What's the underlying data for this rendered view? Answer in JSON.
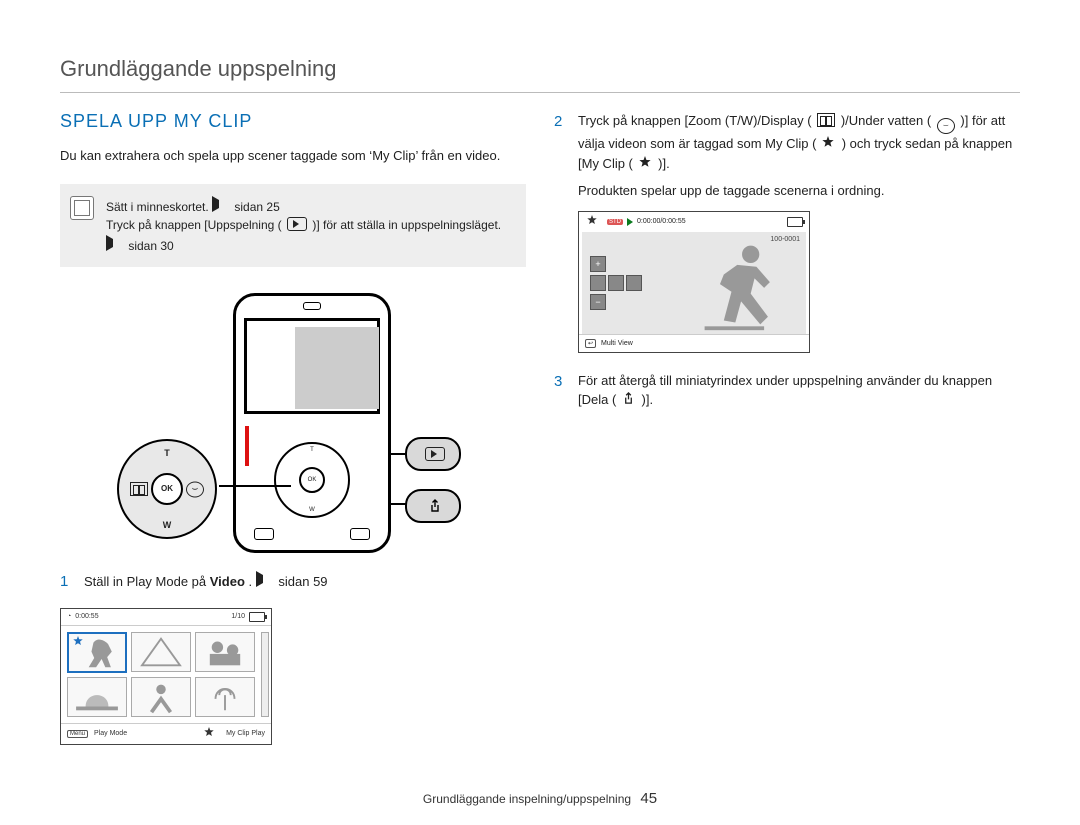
{
  "chapter_title": "Grundläggande uppspelning",
  "section_title": "SPELA UPP MY CLIP",
  "intro": "Du kan extrahera och spela upp scener taggade som ‘My Clip’ från en video.",
  "note": {
    "l1_pre": "Sätt i minneskortet. ",
    "l1_ref": "sidan 25",
    "l2_pre": "Tryck på knappen [Uppspelning (",
    "l2_post": ")] för att ställa in uppspelningsläget. ",
    "l2_ref": "sidan 30"
  },
  "device": {
    "ok": "OK",
    "t": "T",
    "w": "W"
  },
  "zoompad": {
    "ok": "OK",
    "t": "T",
    "w": "W"
  },
  "steps": {
    "s1_num": "1",
    "s1_body_pre": "Ställ in Play Mode på ",
    "s1_body_bold": "Video",
    "s1_body_post": ". ",
    "s1_ref": "sidan 59",
    "s2_num": "2",
    "s2_body_pre": "Tryck på knappen [Zoom (T/W)/Display (",
    "s2_body_mid1": ")/Under vatten (",
    "s2_body_mid2": ")] för att välja videon som är taggad som My Clip (",
    "s2_body_mid3": ") och tryck sedan på knappen [My Clip (",
    "s2_body_end": ")].",
    "s2_sub": "Produkten spelar upp de taggade scenerna i ordning.",
    "s3_num": "3",
    "s3_body_pre": "För att återgå till miniatyrindex under uppspelning använder du knappen [Dela (",
    "s3_body_end": ")]."
  },
  "vshot": {
    "time": "0:00:55",
    "counter": "1/10",
    "menu_tag": "Menu",
    "menu_label": "Play Mode",
    "clip_label": "My Clip Play"
  },
  "pshot": {
    "badge": "STD",
    "time": "0:00:00/0:00:55",
    "file": "100-0001",
    "return_tag": "↩",
    "return_label": "Multi View"
  },
  "footer": {
    "text": "Grundläggande inspelning/uppspelning",
    "page": "45"
  }
}
